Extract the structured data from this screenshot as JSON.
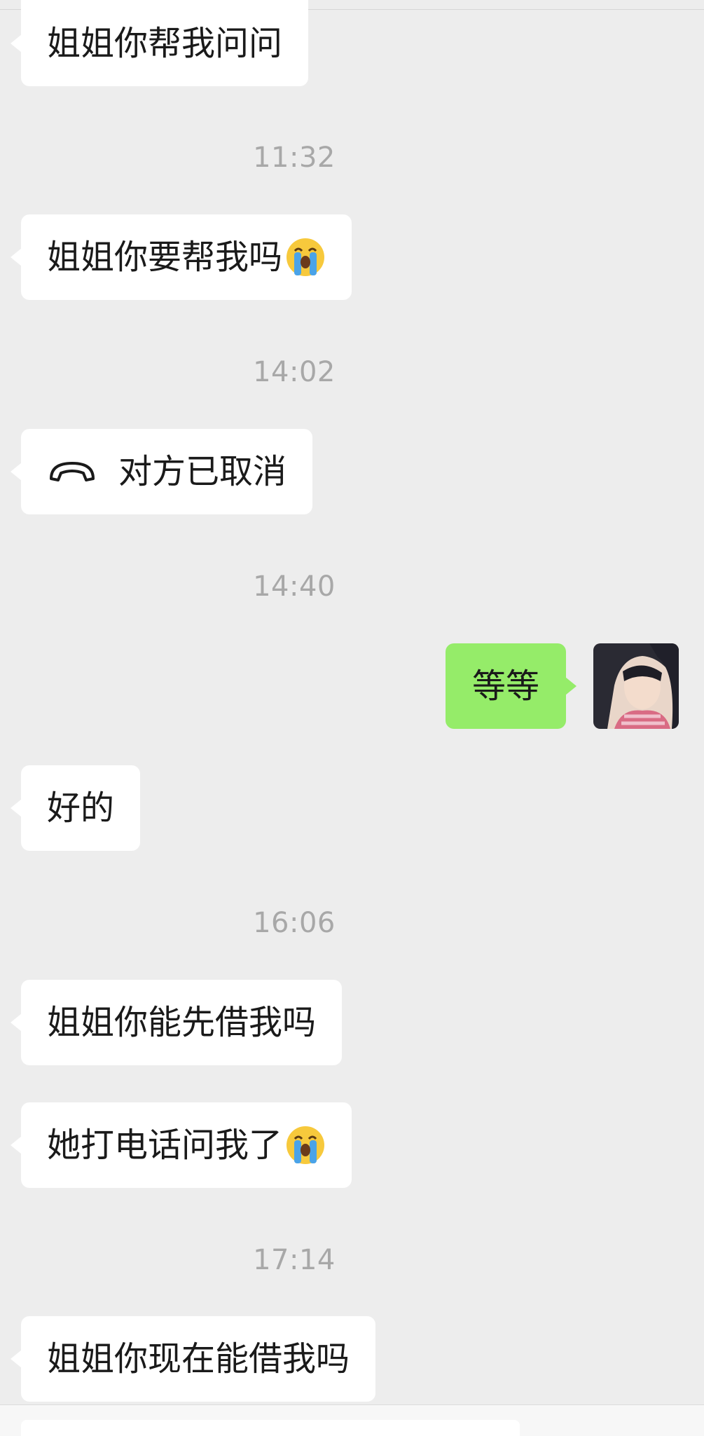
{
  "messages": [
    {
      "text": "姐姐你帮我问问"
    },
    {
      "text": "姐姐你要帮我吗"
    },
    {
      "call_text": "对方已取消"
    },
    {
      "text": "等等"
    },
    {
      "text": "好的"
    },
    {
      "text": "姐姐你能先借我吗"
    },
    {
      "text": "她打电话问我了"
    },
    {
      "text": "姐姐你现在能借我吗"
    }
  ],
  "timestamps": [
    "11:32",
    "14:02",
    "14:40",
    "16:06",
    "17:14"
  ],
  "colors": {
    "background": "#ededed",
    "incoming_bubble": "#ffffff",
    "outgoing_bubble": "#95ec69",
    "timestamp": "#a8a8a8"
  },
  "icons": [
    "crying-face-emoji",
    "hang-up-phone-icon"
  ]
}
